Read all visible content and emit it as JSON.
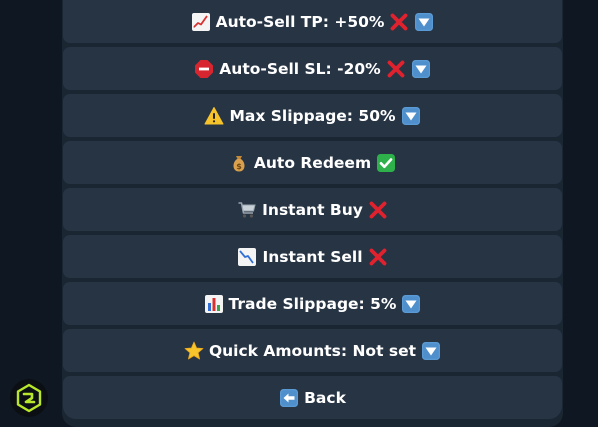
{
  "buttons": [
    {
      "label": "Auto-Sell TP: +50%",
      "lead_icon": "chart-increasing-icon",
      "trail_icons": [
        "cross-mark-icon",
        "down-arrow-button-icon"
      ]
    },
    {
      "label": "Auto-Sell SL: -20%",
      "lead_icon": "stop-sign-icon",
      "trail_icons": [
        "cross-mark-icon",
        "down-arrow-button-icon"
      ]
    },
    {
      "label": "Max Slippage: 50%",
      "lead_icon": "warning-icon",
      "trail_icons": [
        "down-arrow-button-icon"
      ]
    },
    {
      "label": "Auto Redeem",
      "lead_icon": "money-bag-icon",
      "trail_icons": [
        "check-mark-button-icon"
      ]
    },
    {
      "label": "Instant Buy",
      "lead_icon": "shopping-cart-icon",
      "trail_icons": [
        "cross-mark-icon"
      ]
    },
    {
      "label": "Instant Sell",
      "lead_icon": "chart-decreasing-icon",
      "trail_icons": [
        "cross-mark-icon"
      ]
    },
    {
      "label": "Trade Slippage: 5%",
      "lead_icon": "bar-chart-icon",
      "trail_icons": [
        "down-arrow-button-icon"
      ]
    },
    {
      "label": "Quick Amounts: Not set",
      "lead_icon": "star-icon",
      "trail_icons": [
        "down-arrow-button-icon"
      ]
    },
    {
      "label": "Back",
      "lead_icon": "left-arrow-button-icon",
      "trail_icons": []
    }
  ],
  "colors": {
    "background": "#0f1722",
    "keyboard_panel": "#1b2633",
    "button": "#273444",
    "text": "#ffffff",
    "cross": "#e0212e",
    "check": "#2eb04b",
    "arrow_button": "#5b9bd5",
    "avatar_accent": "#b8e62a"
  }
}
